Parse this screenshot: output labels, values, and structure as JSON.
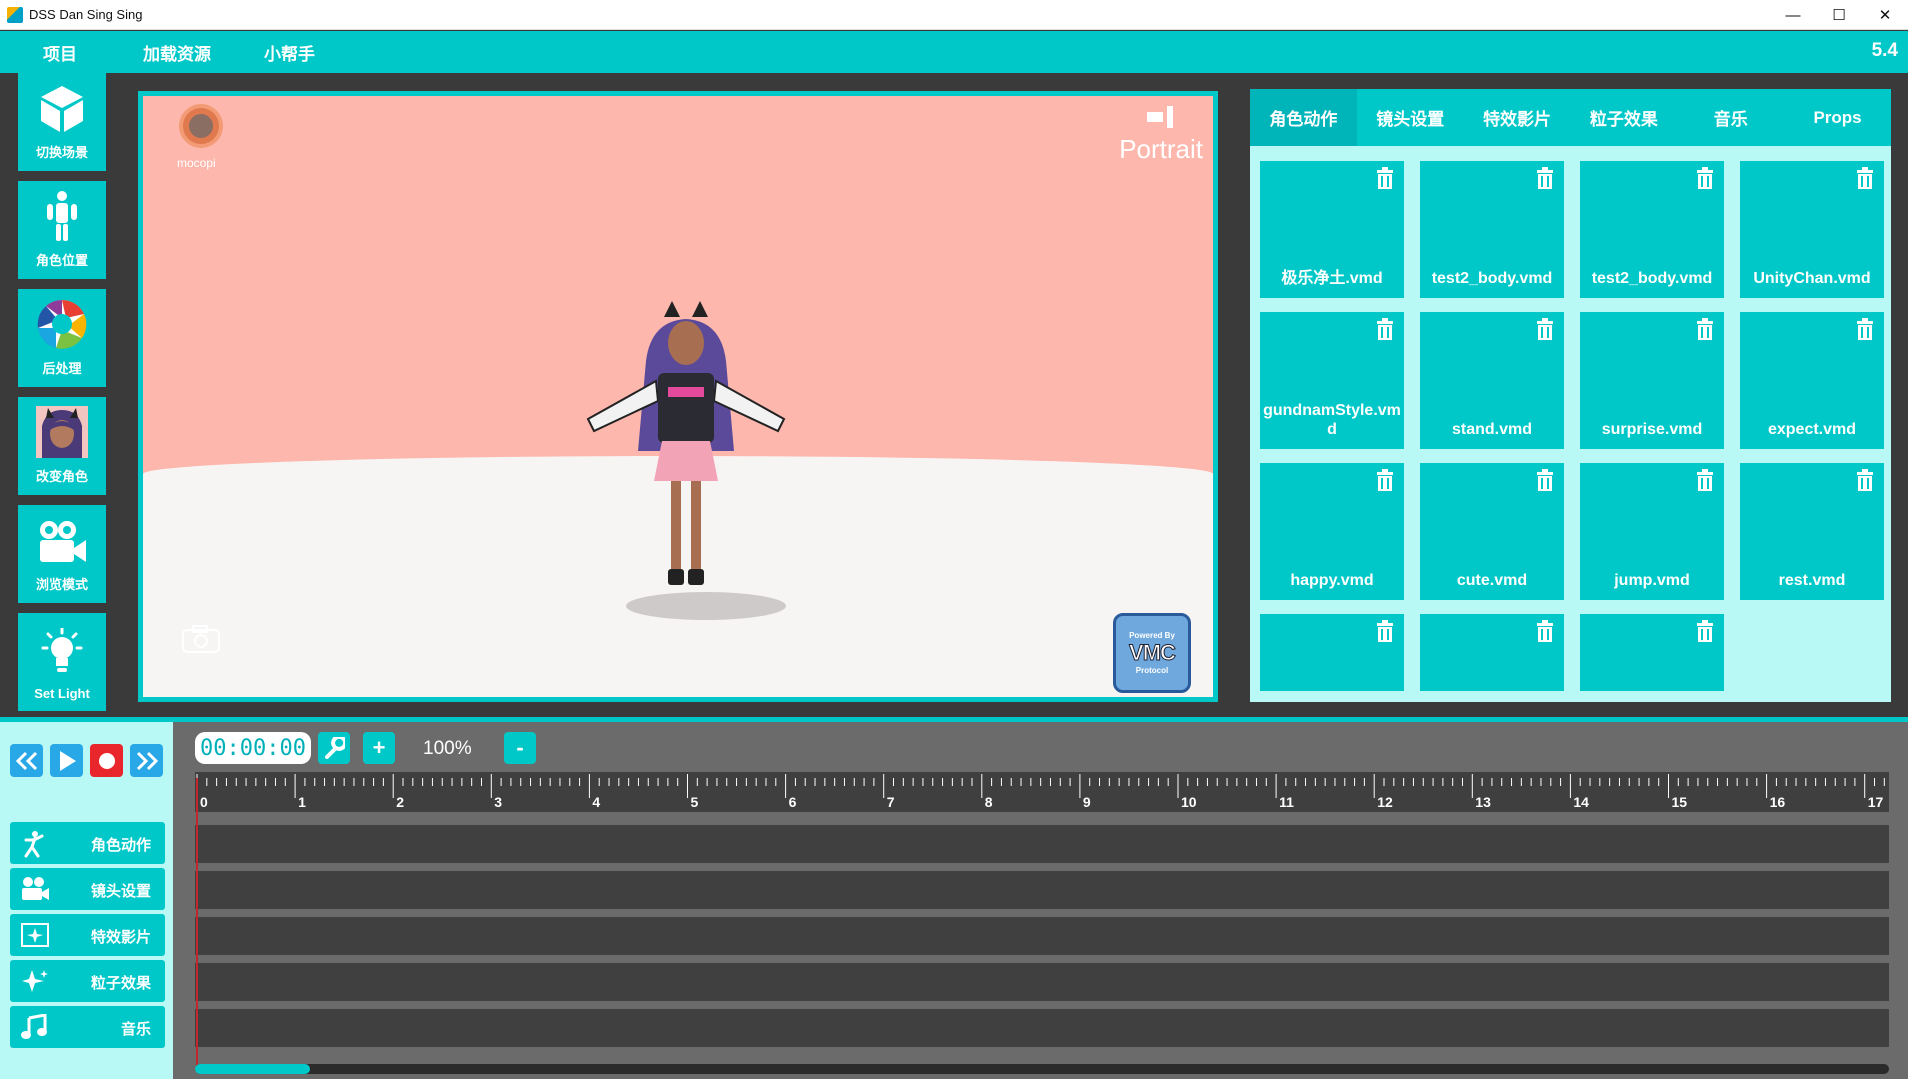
{
  "window": {
    "title": "DSS Dan Sing Sing",
    "minimize": "—",
    "maximize": "☐",
    "close": "✕"
  },
  "menu": {
    "items": [
      "项目",
      "加载资源",
      "小帮手"
    ],
    "version": "5.4"
  },
  "sidebar": {
    "items": [
      {
        "label": "切换场景",
        "icon": "cube-icon"
      },
      {
        "label": "角色位置",
        "icon": "person-position-icon"
      },
      {
        "label": "后处理",
        "icon": "aperture-icon"
      },
      {
        "label": "改变角色",
        "icon": "avatar-icon"
      },
      {
        "label": "浏览模式",
        "icon": "video-camera-icon"
      },
      {
        "label": "Set Light",
        "icon": "lightbulb-icon"
      }
    ]
  },
  "viewport": {
    "mocopi_label": "mocopi",
    "orientation_label": "Portrait",
    "vmc": {
      "top": "Powered By",
      "main": "VMC",
      "bottom": "Protocol"
    }
  },
  "right_panel": {
    "tabs": [
      "角色动作",
      "镜头设置",
      "特效影片",
      "粒子效果",
      "音乐",
      "Props"
    ],
    "active_tab": 0,
    "motions": [
      "极乐净土.vmd",
      "test2_body.vmd",
      "test2_body.vmd",
      "UnityChan.vmd",
      "gundnamStyle.vmd",
      "stand.vmd",
      "surprise.vmd",
      "expect.vmd",
      "happy.vmd",
      "cute.vmd",
      "jump.vmd",
      "rest.vmd",
      "",
      "",
      ""
    ]
  },
  "playback": {
    "buttons": [
      "rewind",
      "play",
      "record",
      "fast-forward"
    ]
  },
  "tracks": [
    {
      "label": "角色动作",
      "icon": "dance-icon"
    },
    {
      "label": "镜头设置",
      "icon": "camera-icon"
    },
    {
      "label": "特效影片",
      "icon": "effect-film-icon"
    },
    {
      "label": "粒子效果",
      "icon": "sparkle-icon"
    },
    {
      "label": "音乐",
      "icon": "music-note-icon"
    }
  ],
  "timeline": {
    "timecode": "00:00:00",
    "zoom": "100%",
    "add_label": "+",
    "remove_label": "-",
    "ticks": [
      "0",
      "1",
      "2",
      "3",
      "4",
      "5",
      "6",
      "7",
      "8",
      "9",
      "10",
      "11",
      "12",
      "13",
      "14",
      "15",
      "16",
      "17"
    ]
  },
  "colors": {
    "accent": "#00c8c8",
    "panel_bg": "#b8f9f6",
    "dark_bg": "#3a3a3a",
    "record": "#e8262c"
  }
}
